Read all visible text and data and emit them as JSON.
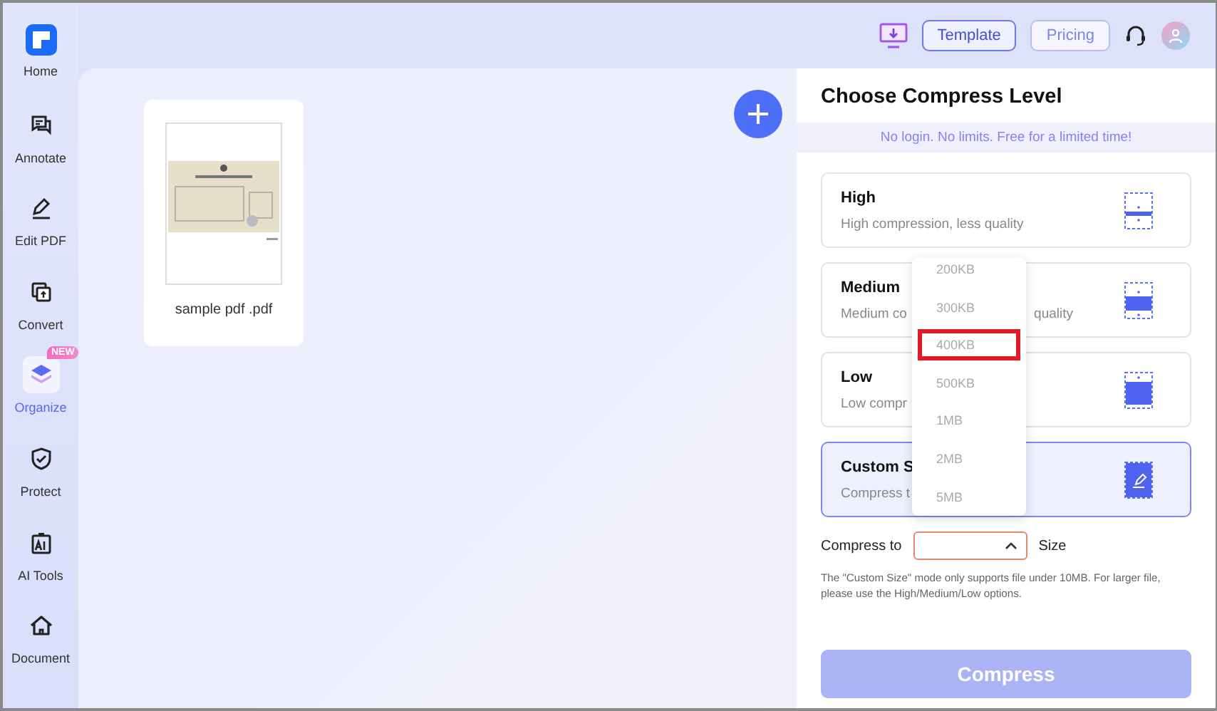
{
  "sidebar": {
    "items": [
      {
        "label": "Home",
        "kind": "logo",
        "selected": false
      },
      {
        "label": "Annotate",
        "kind": "annotate",
        "selected": false
      },
      {
        "label": "Edit PDF",
        "kind": "edit",
        "selected": false
      },
      {
        "label": "Convert",
        "kind": "convert",
        "selected": false
      },
      {
        "label": "Organize",
        "kind": "organize",
        "selected": true,
        "badge": "NEW"
      },
      {
        "label": "Protect",
        "kind": "protect",
        "selected": false
      },
      {
        "label": "AI Tools",
        "kind": "ai",
        "selected": false
      },
      {
        "label": "Document",
        "kind": "document",
        "selected": false
      }
    ]
  },
  "topbar": {
    "buttons": [
      {
        "label": "Template",
        "kind": "outline"
      },
      {
        "label": "Pricing",
        "kind": "light"
      }
    ]
  },
  "files": [
    {
      "name": "sample pdf .pdf"
    }
  ],
  "panel": {
    "title": "Choose Compress Level",
    "banner": "No login. No limits. Free for a limited time!",
    "levels": [
      {
        "kind": "high",
        "title": "High",
        "desc": "High compression, less quality",
        "selected": false
      },
      {
        "kind": "medium",
        "title": "Medium",
        "desc": "Medium co",
        "desc_tail": "quality",
        "selected": false
      },
      {
        "kind": "low",
        "title": "Low",
        "desc": "Low compr",
        "selected": false
      },
      {
        "kind": "custom",
        "title": "Custom S",
        "desc": "Compress t",
        "selected": true
      }
    ],
    "compress_label": "Compress to",
    "size_label": "Size",
    "dropdown": {
      "options": [
        {
          "label": "200KB",
          "selected": false
        },
        {
          "label": "300KB",
          "selected": false
        },
        {
          "label": "400KB",
          "selected": true
        },
        {
          "label": "500KB",
          "selected": false
        },
        {
          "label": "1MB",
          "selected": false
        },
        {
          "label": "2MB",
          "selected": false
        },
        {
          "label": "5MB",
          "selected": false
        }
      ]
    },
    "note": "The \"Custom Size\" mode only supports file under 10MB. For larger file, please use the High/Medium/Low options.",
    "compress_button": {
      "label": "Compress",
      "disabled": true
    }
  }
}
